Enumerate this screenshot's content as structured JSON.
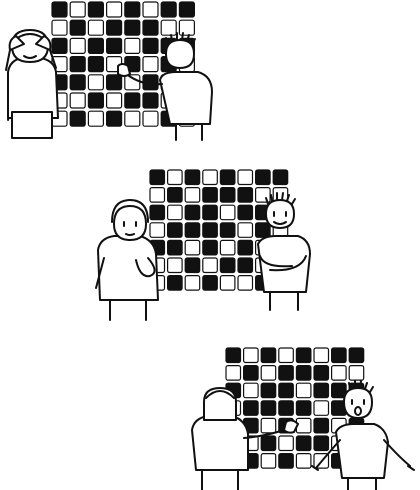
{
  "colors": {
    "ink": "#111111",
    "paper": "#ffffff"
  },
  "panels": [
    {
      "grid": [
        [
          1,
          0,
          1,
          0,
          1,
          0,
          1,
          1
        ],
        [
          0,
          1,
          0,
          1,
          1,
          1,
          0,
          0
        ],
        [
          1,
          0,
          1,
          1,
          0,
          1,
          1,
          1
        ],
        [
          0,
          1,
          1,
          0,
          1,
          0,
          1,
          0
        ],
        [
          1,
          1,
          0,
          1,
          0,
          1,
          0,
          1
        ],
        [
          0,
          0,
          1,
          0,
          1,
          1,
          0,
          1
        ],
        [
          0,
          1,
          0,
          1,
          0,
          0,
          1,
          0
        ]
      ]
    },
    {
      "grid": [
        [
          1,
          0,
          1,
          0,
          1,
          0,
          1,
          1
        ],
        [
          0,
          1,
          0,
          1,
          1,
          1,
          0,
          0
        ],
        [
          1,
          0,
          1,
          1,
          0,
          1,
          1,
          1
        ],
        [
          0,
          1,
          1,
          1,
          1,
          0,
          1,
          0
        ],
        [
          1,
          1,
          0,
          1,
          0,
          1,
          0,
          1
        ],
        [
          0,
          0,
          1,
          0,
          1,
          1,
          0,
          1
        ],
        [
          0,
          1,
          0,
          1,
          0,
          0,
          1,
          0
        ]
      ]
    },
    {
      "grid": [
        [
          1,
          0,
          1,
          0,
          1,
          0,
          1,
          1
        ],
        [
          0,
          1,
          0,
          1,
          1,
          1,
          0,
          0
        ],
        [
          1,
          0,
          1,
          1,
          0,
          1,
          1,
          1
        ],
        [
          0,
          1,
          1,
          1,
          1,
          0,
          1,
          0
        ],
        [
          1,
          1,
          0,
          1,
          0,
          1,
          0,
          1
        ],
        [
          0,
          0,
          1,
          0,
          1,
          1,
          0,
          1
        ],
        [
          0,
          1,
          0,
          1,
          0,
          0,
          1,
          0
        ]
      ]
    }
  ]
}
